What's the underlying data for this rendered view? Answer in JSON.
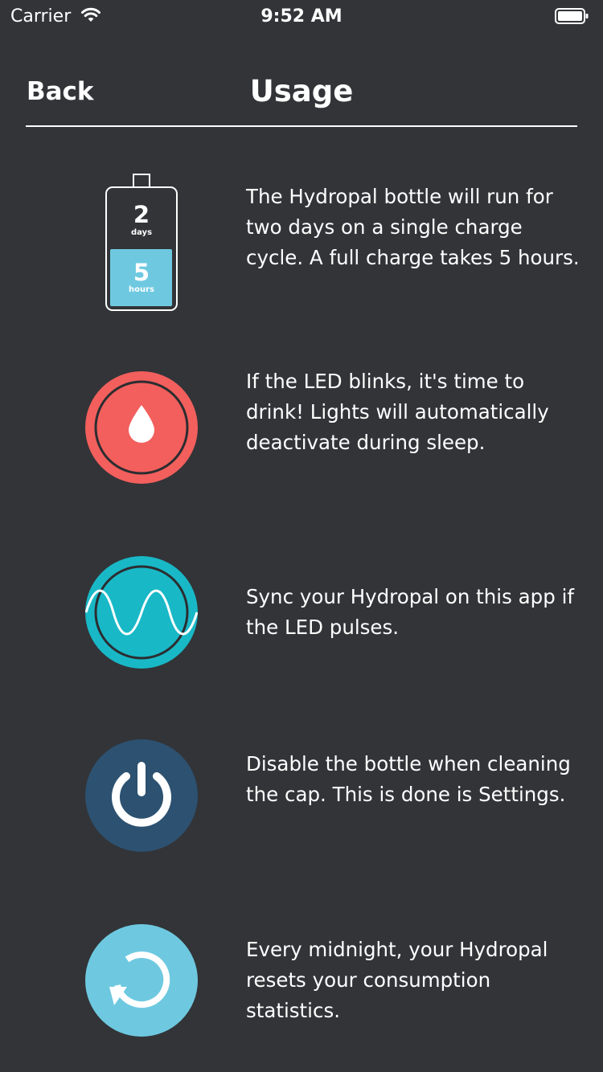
{
  "status_bar": {
    "carrier": "Carrier",
    "time": "9:52 AM"
  },
  "nav": {
    "back_label": "Back",
    "title": "Usage"
  },
  "tips": [
    {
      "icon": "battery-icon",
      "battery": {
        "days_value": "2",
        "days_unit": "days",
        "hours_value": "5",
        "hours_unit": "hours"
      },
      "text": "The Hydropal bottle will run for two days on a single charge cycle. A full charge takes 5 hours."
    },
    {
      "icon": "water-drop-icon",
      "color": "#f25f5c",
      "text": "If the LED blinks, it's time to drink! Lights will automatically deactivate during sleep."
    },
    {
      "icon": "sine-wave-icon",
      "color": "#19b8c6",
      "text": "Sync your Hydropal on this app if the LED pulses."
    },
    {
      "icon": "power-icon",
      "color": "#2d5170",
      "text": "Disable the bottle when cleaning the cap. This is done is Settings."
    },
    {
      "icon": "refresh-icon",
      "color": "#6ec9e0",
      "text": "Every midnight, your Hydropal resets your consumption statistics."
    }
  ],
  "colors": {
    "background": "#323438",
    "text": "#ffffff",
    "battery_fill": "#6ec9e0"
  }
}
